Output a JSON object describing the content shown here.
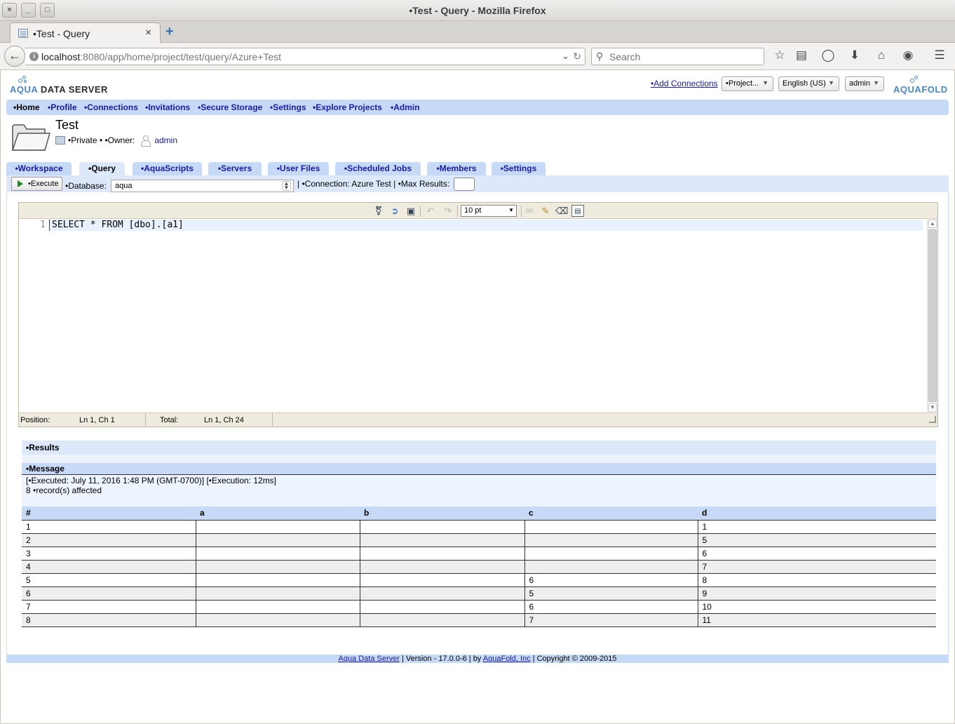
{
  "window": {
    "title": "•Test - Query - Mozilla Firefox",
    "close_glyph": "×",
    "minimize_glyph": "_",
    "maximize_glyph": "□"
  },
  "browser": {
    "tab_label": "•Test - Query",
    "tab_close": "×",
    "new_tab": "+",
    "url_host": "localhost",
    "url_rest": ":8080/app/home/project/test/query/Azure+Test",
    "search_placeholder": "Search"
  },
  "app": {
    "logo_aqua": "AQUA",
    "logo_data_server": " DATA SERVER",
    "brand_logo": "AQUAFOLD",
    "add_connections": "•Add Connections",
    "project_select": "•Project...",
    "language_select": "English (US)",
    "user_select": "admin"
  },
  "menu": [
    "•Home",
    "•Profile",
    "•Connections",
    "•Invitations",
    "•Secure Storage",
    "•Settings",
    "•Explore Projects",
    "•Admin"
  ],
  "project": {
    "title": "Test",
    "visibility": "•Private •",
    "owner_label": "•Owner:",
    "owner": "admin"
  },
  "tabs": [
    "•Workspace",
    "•Query",
    "•AquaScripts",
    "•Servers",
    "•User Files",
    "•Scheduled Jobs",
    "•Members",
    "•Settings"
  ],
  "active_tab": "•Query",
  "query_toolbar": {
    "execute": "•Execute",
    "database_label": "•Database:",
    "database_value": "aqua",
    "connection_info": "| •Connection: Azure Test | •Max Results:",
    "max_results": ""
  },
  "editor": {
    "font_size": "10 pt",
    "line_number": "1",
    "code": "SELECT * FROM [dbo].[a1]",
    "position_label": "Position:",
    "position_value": "Ln 1, Ch 1",
    "total_label": "Total:",
    "total_value": "Ln 1, Ch 24"
  },
  "results": {
    "title": "•Results",
    "message_title": "•Message",
    "executed_line": "[•Executed: July 11, 2016 1:48 PM (GMT-0700)] [•Execution: 12ms]",
    "affected_line": "8 •record(s) affected",
    "columns": [
      "#",
      "a",
      "b",
      "c",
      "d"
    ],
    "rows": [
      [
        "1",
        "",
        "",
        "",
        "1"
      ],
      [
        "2",
        "",
        "",
        "",
        "5"
      ],
      [
        "3",
        "",
        "",
        "",
        "6"
      ],
      [
        "4",
        "",
        "",
        "",
        "7"
      ],
      [
        "5",
        "",
        "",
        "6",
        "8"
      ],
      [
        "6",
        "",
        "",
        "5",
        "9"
      ],
      [
        "7",
        "",
        "",
        "6",
        "10"
      ],
      [
        "8",
        "",
        "",
        "7",
        "11"
      ]
    ]
  },
  "footer": {
    "product_link": "Aqua Data Server",
    "version_text": " | Version - 17.0.0-6 | by ",
    "company_link": "AquaFold, Inc",
    "copyright_text": " | Copyright © 2009-2015"
  },
  "colors": {
    "accent": "#c6daf7",
    "link": "#1a1aa6",
    "brand": "#4a86c8"
  }
}
